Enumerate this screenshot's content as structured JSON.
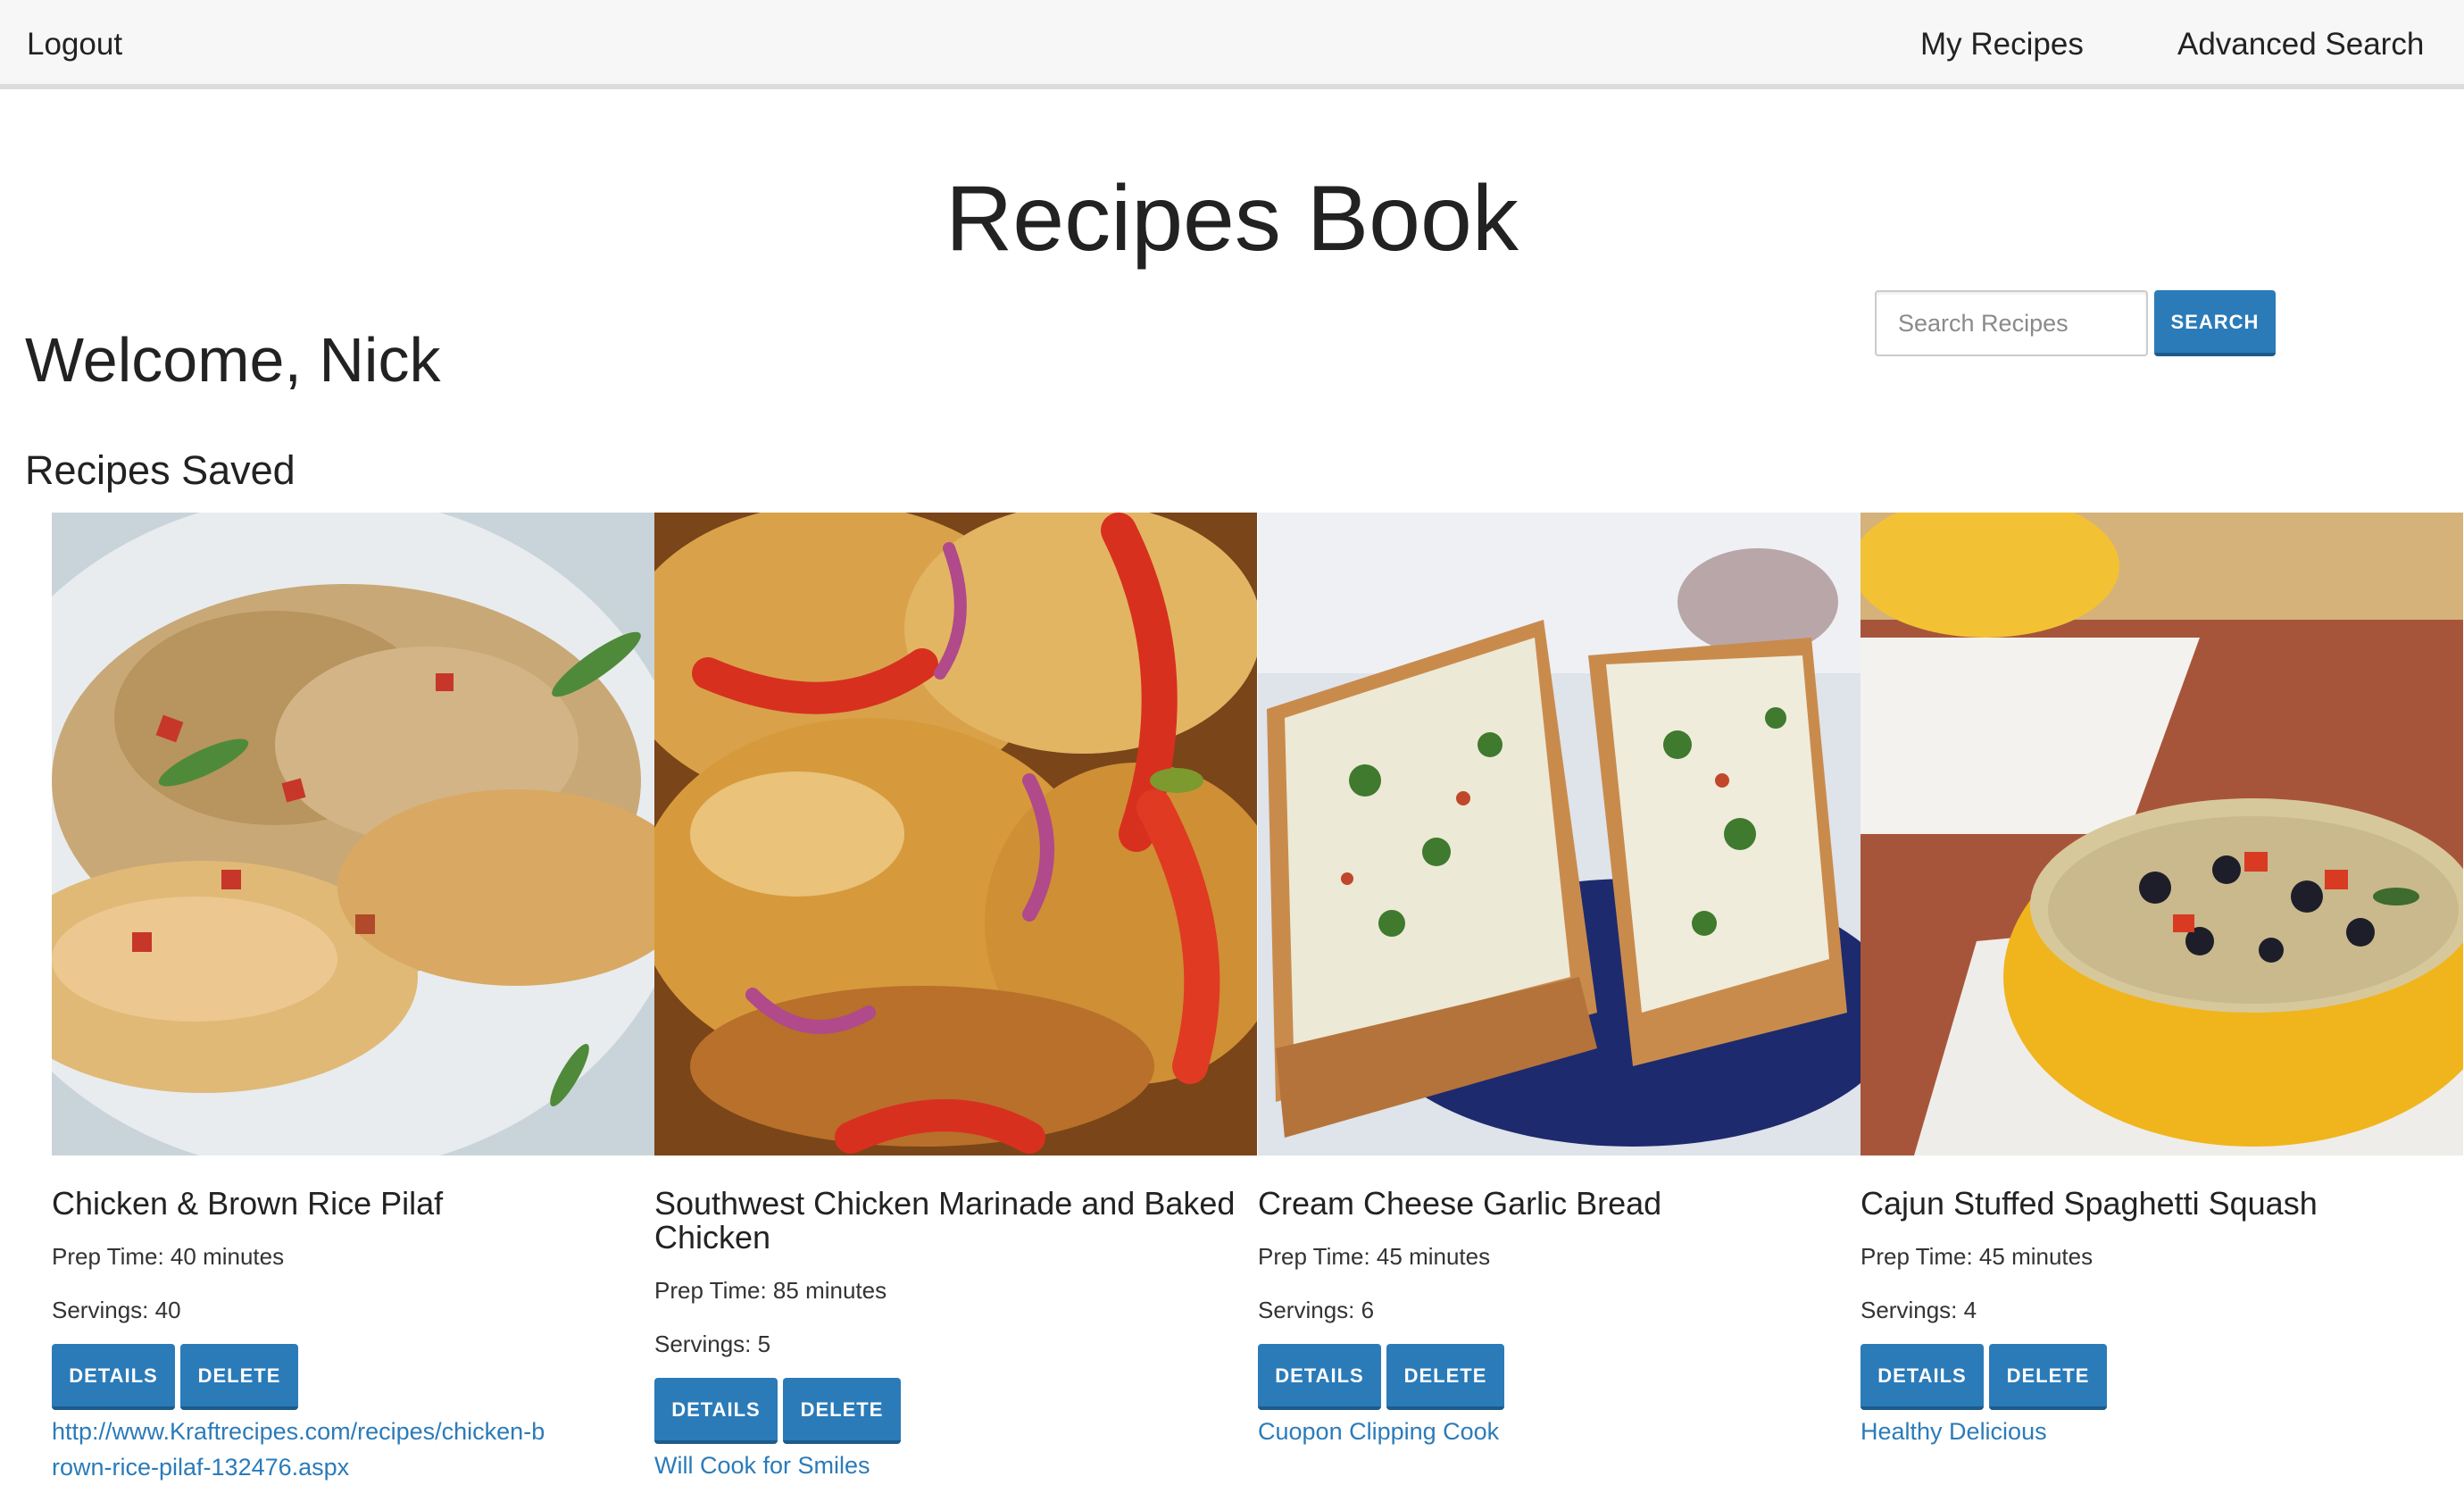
{
  "nav": {
    "logout": "Logout",
    "my_recipes": "My Recipes",
    "advanced_search": "Advanced Search"
  },
  "page_title": "Recipes Book",
  "welcome": "Welcome, Nick",
  "search": {
    "placeholder": "Search Recipes",
    "button": "SEARCH"
  },
  "section_heading": "Recipes Saved",
  "recipes": [
    {
      "title": "Chicken & Brown Rice Pilaf",
      "prep_time": "Prep Time: 40 minutes",
      "servings": "Servings: 40",
      "details_label": "DETAILS",
      "delete_label": "DELETE",
      "source": "http://www.Kraftrecipes.com/recipes/chicken-brown-rice-pilaf-132476.aspx"
    },
    {
      "title": "Southwest Chicken Marinade and Baked Chicken",
      "prep_time": "Prep Time: 85 minutes",
      "servings": "Servings: 5",
      "details_label": "DETAILS",
      "delete_label": "DELETE",
      "source": "Will Cook for Smiles"
    },
    {
      "title": "Cream Cheese Garlic Bread",
      "prep_time": "Prep Time: 45 minutes",
      "servings": "Servings: 6",
      "details_label": "DETAILS",
      "delete_label": "DELETE",
      "source": "Cuopon Clipping Cook"
    },
    {
      "title": "Cajun Stuffed Spaghetti Squash",
      "prep_time": "Prep Time: 45 minutes",
      "servings": "Servings: 4",
      "details_label": "DETAILS",
      "delete_label": "DELETE",
      "source": "Healthy Delicious"
    }
  ],
  "colors": {
    "primary_button": "#2b7bb9",
    "link": "#2b7bb9",
    "topbar_bg": "#f7f7f7"
  }
}
